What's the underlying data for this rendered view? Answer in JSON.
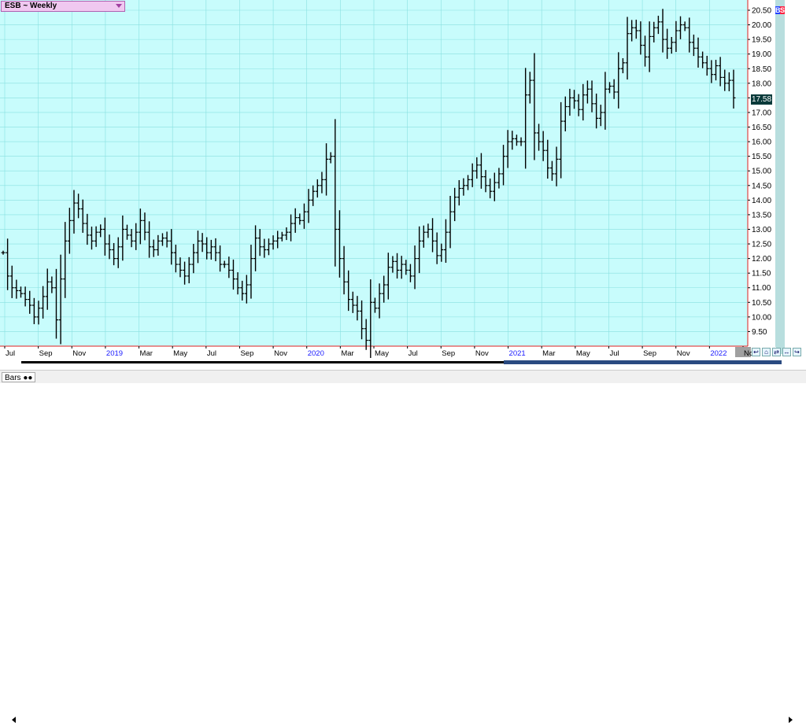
{
  "header": {
    "title": "ESB ~ Weekly"
  },
  "badge": {
    "b": "B",
    "s": "S"
  },
  "status": {
    "tab_label": "Bars"
  },
  "last_price_label": "17.58",
  "colors": {
    "plot_bg": "#c8fcfc",
    "grid": "#88e0e0",
    "bar": "#000000",
    "accent": "#e02020",
    "axis_bg": "#ffffff"
  },
  "chart_data": {
    "type": "ohlc-bar",
    "title": "ESB ~ Weekly",
    "ylim": [
      9.0,
      20.85
    ],
    "y_ticks": [
      "20.50",
      "20.00",
      "19.50",
      "19.00",
      "18.50",
      "18.00",
      "17.50",
      "17.00",
      "16.50",
      "16.00",
      "15.50",
      "15.00",
      "14.50",
      "14.00",
      "13.50",
      "13.00",
      "12.50",
      "12.00",
      "11.50",
      "11.00",
      "10.50",
      "10.00",
      "9.50"
    ],
    "x_ticks": [
      {
        "label": "Jul",
        "year": false
      },
      {
        "label": "Sep",
        "year": false
      },
      {
        "label": "Nov",
        "year": false
      },
      {
        "label": "2019",
        "year": true
      },
      {
        "label": "Mar",
        "year": false
      },
      {
        "label": "May",
        "year": false
      },
      {
        "label": "Jul",
        "year": false
      },
      {
        "label": "Sep",
        "year": false
      },
      {
        "label": "Nov",
        "year": false
      },
      {
        "label": "2020",
        "year": true
      },
      {
        "label": "Mar",
        "year": false
      },
      {
        "label": "May",
        "year": false
      },
      {
        "label": "Jul",
        "year": false
      },
      {
        "label": "Sep",
        "year": false
      },
      {
        "label": "Nov",
        "year": false
      },
      {
        "label": "2021",
        "year": true
      },
      {
        "label": "Mar",
        "year": false
      },
      {
        "label": "May",
        "year": false
      },
      {
        "label": "Jul",
        "year": false
      },
      {
        "label": "Sep",
        "year": false
      },
      {
        "label": "Nov",
        "year": false
      },
      {
        "label": "2022",
        "year": true
      },
      {
        "label": "Nov",
        "year": false,
        "highlight": true
      }
    ],
    "last_price": 17.58,
    "grid": true,
    "closes": [
      12.2,
      11.4,
      11.0,
      10.9,
      10.8,
      10.6,
      10.4,
      10.0,
      10.3,
      10.7,
      11.2,
      11.0,
      9.9,
      11.3,
      12.6,
      13.3,
      13.9,
      13.7,
      13.2,
      12.8,
      12.6,
      12.9,
      13.0,
      12.5,
      12.3,
      12.0,
      12.4,
      13.0,
      12.8,
      12.6,
      12.9,
      13.3,
      12.9,
      12.4,
      12.3,
      12.6,
      12.7,
      12.6,
      12.2,
      11.8,
      11.6,
      11.4,
      11.8,
      12.2,
      12.6,
      12.5,
      12.2,
      12.4,
      12.2,
      11.8,
      11.8,
      11.6,
      11.3,
      11.0,
      10.8,
      11.1,
      12.0,
      12.7,
      12.4,
      12.3,
      12.5,
      12.6,
      12.7,
      12.8,
      12.9,
      13.2,
      13.4,
      13.3,
      13.6,
      14.0,
      14.3,
      14.5,
      14.7,
      15.4,
      15.5,
      13.0,
      12.0,
      11.2,
      10.6,
      10.4,
      10.2,
      9.6,
      9.2,
      10.5,
      10.3,
      10.8,
      11.1,
      11.7,
      11.9,
      11.6,
      11.8,
      11.6,
      11.4,
      12.0,
      12.6,
      12.9,
      13.0,
      12.6,
      12.1,
      12.3,
      12.9,
      13.6,
      14.1,
      14.4,
      14.5,
      14.7,
      15.0,
      15.2,
      14.8,
      14.5,
      14.3,
      14.6,
      14.9,
      15.5,
      16.0,
      16.1,
      16.0,
      16.0,
      17.6,
      18.1,
      16.3,
      16.0,
      15.7,
      15.1,
      14.9,
      15.4,
      16.7,
      17.2,
      17.5,
      17.4,
      17.1,
      17.6,
      17.8,
      17.3,
      16.8,
      17.0,
      17.8,
      17.9,
      17.7,
      18.5,
      18.7,
      19.7,
      19.9,
      19.8,
      19.3,
      18.9,
      19.6,
      19.9,
      20.1,
      19.5,
      19.2,
      19.4,
      19.8,
      20.0,
      19.9,
      19.4,
      19.2,
      18.9,
      18.7,
      18.5,
      18.3,
      18.6,
      18.2,
      18.0,
      18.1,
      17.5
    ],
    "series": [
      {
        "name": "ESB",
        "values": []
      }
    ]
  }
}
